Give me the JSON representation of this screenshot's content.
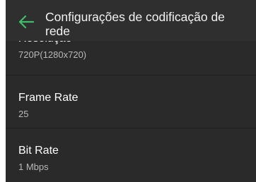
{
  "header": {
    "title": "Configurações de codificação de rede",
    "back_icon": "arrow-left-icon",
    "back_icon_color": "#3dbf6a"
  },
  "settings": [
    {
      "label": "Resolução",
      "value": "720P(1280x720)"
    },
    {
      "label": "Frame Rate",
      "value": "25"
    },
    {
      "label": "Bit Rate",
      "value": "1 Mbps"
    }
  ]
}
